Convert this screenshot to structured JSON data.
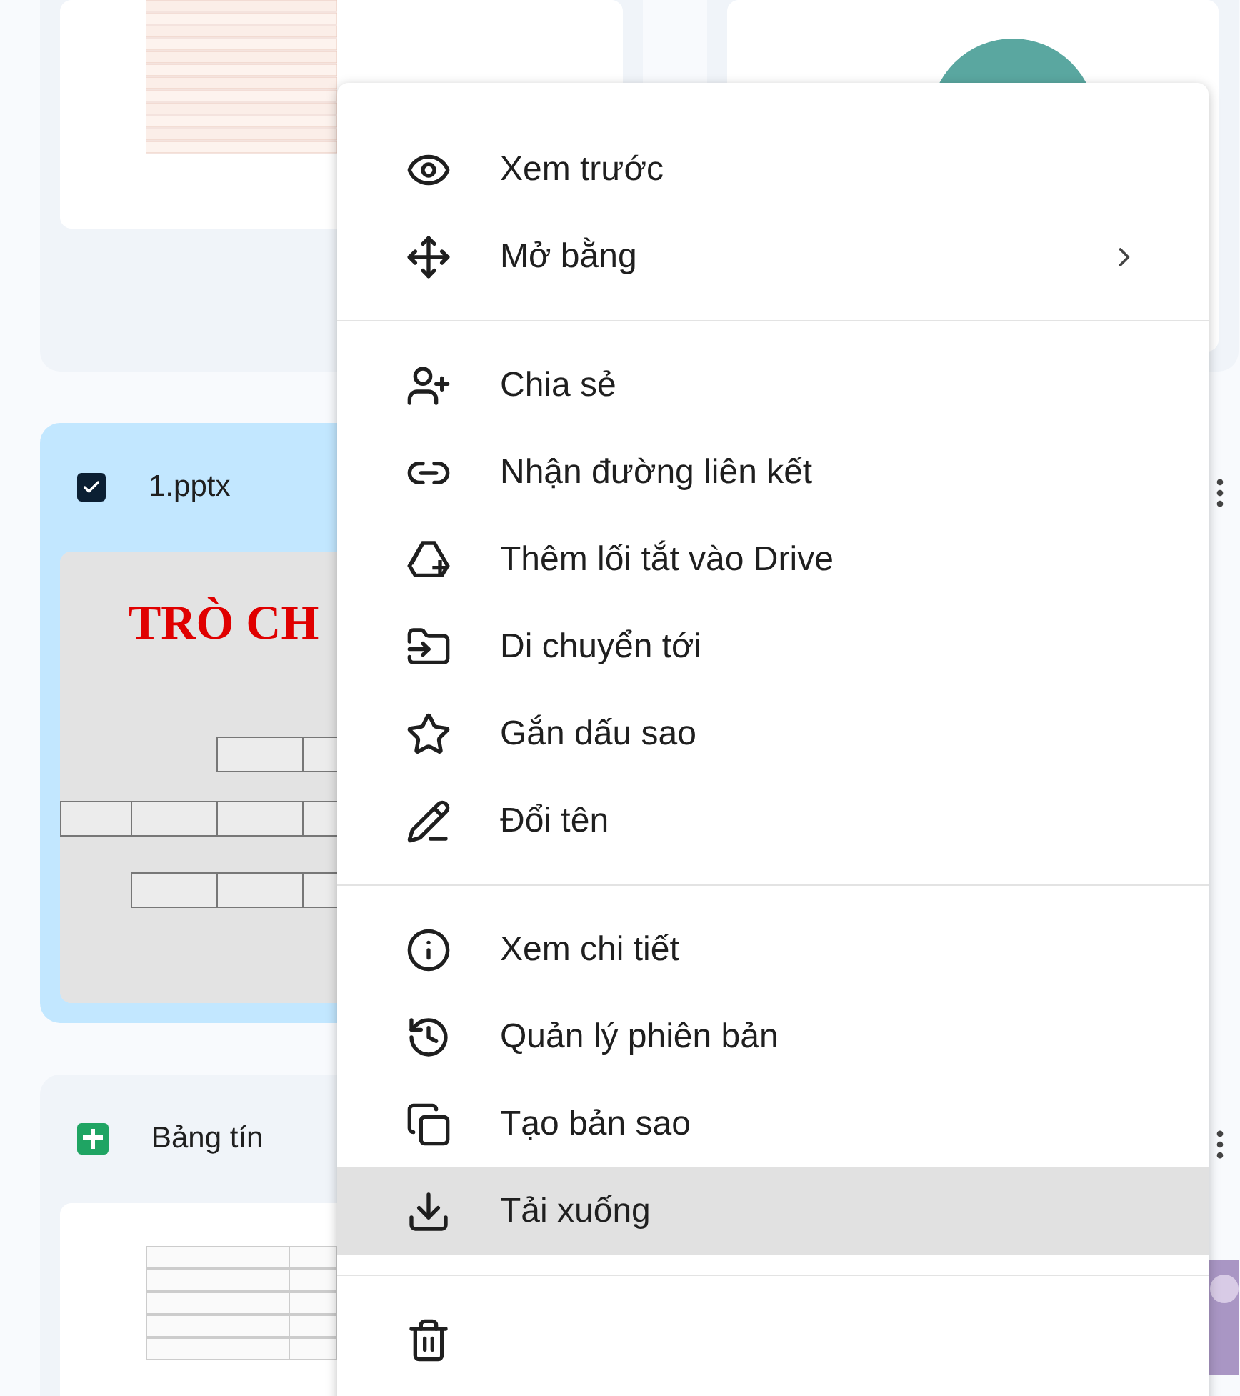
{
  "cards": [
    {
      "kind": "sheet-preview"
    },
    {
      "kind": "avatar-preview"
    },
    {
      "kind": "slides",
      "title": "1.pptx",
      "checked": true,
      "selected": true,
      "slide_title": "TRÒ CH"
    },
    {
      "kind": "more-only"
    },
    {
      "kind": "sheet",
      "title": "Bảng tín",
      "selected": false
    },
    {
      "kind": "photo-more"
    }
  ],
  "menu": {
    "sections": [
      [
        {
          "label": "Xem trước",
          "submenu": false,
          "highlighted": false
        },
        {
          "label": "Mở bằng",
          "submenu": true,
          "highlighted": false
        }
      ],
      [
        {
          "label": "Chia sẻ",
          "submenu": false,
          "highlighted": false
        },
        {
          "label": "Nhận đường liên kết",
          "submenu": false,
          "highlighted": false
        },
        {
          "label": "Thêm lối tắt vào Drive",
          "submenu": false,
          "highlighted": false
        },
        {
          "label": "Di chuyển tới",
          "submenu": false,
          "highlighted": false
        },
        {
          "label": "Gắn dấu sao",
          "submenu": false,
          "highlighted": false
        },
        {
          "label": "Đổi tên",
          "submenu": false,
          "highlighted": false
        }
      ],
      [
        {
          "label": "Xem chi tiết",
          "submenu": false,
          "highlighted": false
        },
        {
          "label": "Quản lý phiên bản",
          "submenu": false,
          "highlighted": false
        },
        {
          "label": "Tạo bản sao",
          "submenu": false,
          "highlighted": false
        },
        {
          "label": "Tải xuống",
          "submenu": false,
          "highlighted": true
        }
      ],
      [
        {
          "submenu": false,
          "highlighted": false
        }
      ]
    ]
  }
}
